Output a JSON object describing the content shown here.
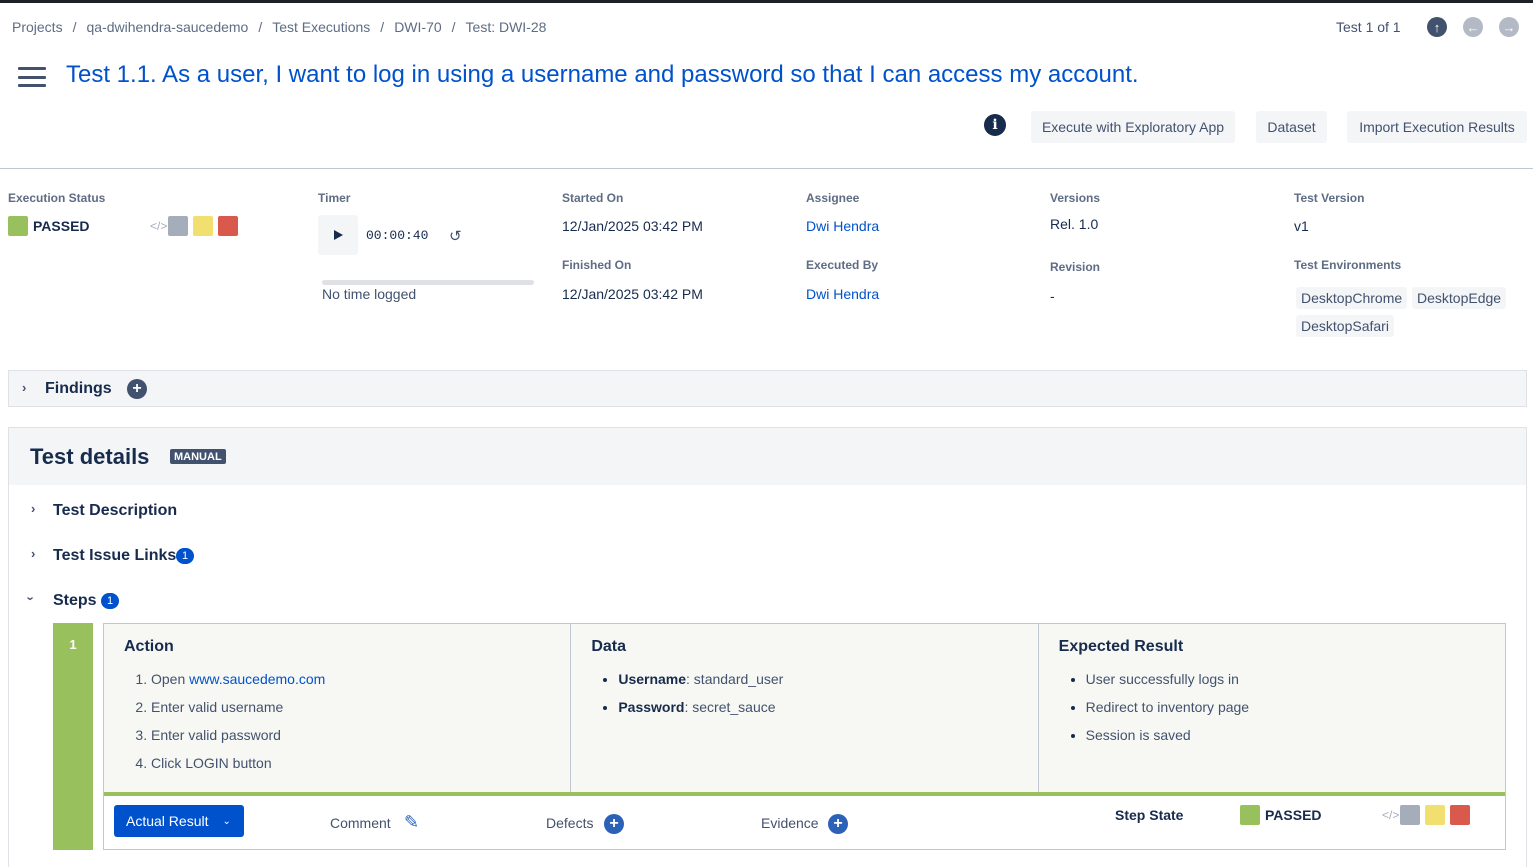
{
  "breadcrumb": [
    "Projects",
    "qa-dwihendra-saucedemo",
    "Test Executions",
    "DWI-70",
    "Test: DWI-28"
  ],
  "pager": {
    "label": "Test 1 of 1",
    "up_icon": "arrow-up-icon",
    "prev_icon": "arrow-left-icon",
    "next_icon": "arrow-right-icon"
  },
  "title": "Test 1.1. As a user, I want to log in using a username and password so that I can access my account.",
  "actions": {
    "explore": "Execute with Exploratory App",
    "dataset": "Dataset",
    "import": "Import Execution Results"
  },
  "execution": {
    "status_label": "Execution Status",
    "status": "PASSED",
    "status_colors": {
      "passed": "#98c05c",
      "todo": "#a5adba",
      "executing": "#f1e06f",
      "failed": "#d9594c"
    },
    "timer_label": "Timer",
    "timer": "00:00:40",
    "timer_note": "No time logged",
    "started_label": "Started On",
    "started": "12/Jan/2025 03:42 PM",
    "finished_label": "Finished On",
    "finished": "12/Jan/2025 03:42 PM",
    "assignee_label": "Assignee",
    "assignee": "Dwi Hendra",
    "executed_by_label": "Executed By",
    "executed_by": "Dwi Hendra",
    "versions_label": "Versions",
    "versions": "Rel. 1.0",
    "revision_label": "Revision",
    "revision": "-",
    "test_version_label": "Test Version",
    "test_version": "v1",
    "env_label": "Test Environments",
    "environments": [
      "DesktopChrome",
      "DesktopEdge",
      "DesktopSafari"
    ]
  },
  "findings": {
    "label": "Findings"
  },
  "details": {
    "title": "Test details",
    "badge": "MANUAL",
    "description_label": "Test Description",
    "links_label": "Test Issue Links",
    "links_count": "1",
    "steps_label": "Steps",
    "steps_count": "1"
  },
  "step": {
    "number": "1",
    "action_title": "Action",
    "actions": [
      "Open ",
      "Enter valid username",
      "Enter valid password",
      "Click LOGIN button"
    ],
    "action_link": "www.saucedemo.com",
    "data_title": "Data",
    "data": [
      {
        "key": "Username",
        "value": ": standard_user"
      },
      {
        "key": "Password",
        "value": ": secret_sauce"
      }
    ],
    "expected_title": "Expected Result",
    "expected": [
      "User successfully logs in",
      "Redirect to inventory page",
      "Session is saved"
    ],
    "actual_result": "Actual Result",
    "comment": "Comment",
    "defects": "Defects",
    "evidence": "Evidence",
    "state_label": "Step State",
    "state": "PASSED"
  }
}
